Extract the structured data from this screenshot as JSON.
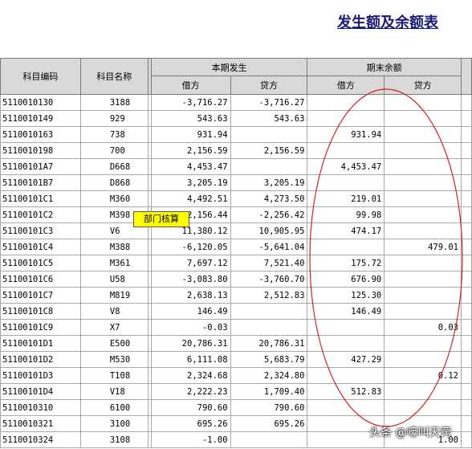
{
  "report": {
    "title": "发生额及余额表"
  },
  "headers": {
    "code": "科目编码",
    "name": "科目名称",
    "period_group": "本期发生",
    "balance_group": "期末余额",
    "debit": "借方",
    "credit": "贷方"
  },
  "rows": [
    {
      "code": "5110010130",
      "name": "3188",
      "pd": "-3,716.27",
      "pc": "-3,716.27",
      "bd": "",
      "bc": ""
    },
    {
      "code": "5110010149",
      "name": "929",
      "pd": "543.63",
      "pc": "543.63",
      "bd": "",
      "bc": ""
    },
    {
      "code": "5110010163",
      "name": "738",
      "pd": "931.94",
      "pc": "",
      "bd": "931.94",
      "bc": ""
    },
    {
      "code": "5110010198",
      "name": "700",
      "pd": "2,156.59",
      "pc": "2,156.59",
      "bd": "",
      "bc": ""
    },
    {
      "code": "51100101A7",
      "name": "D668",
      "pd": "4,453.47",
      "pc": "",
      "bd": "4,453.47",
      "bc": ""
    },
    {
      "code": "51100101B7",
      "name": "D868",
      "pd": "3,205.19",
      "pc": "3,205.19",
      "bd": "",
      "bc": ""
    },
    {
      "code": "51100101C1",
      "name": "M360",
      "pd": "4,492.51",
      "pc": "4,273.50",
      "bd": "219.01",
      "bc": ""
    },
    {
      "code": "51100101C2",
      "name": "M398",
      "pd": "-2,156.44",
      "pc": "-2,256.42",
      "bd": "99.98",
      "bc": ""
    },
    {
      "code": "51100101C3",
      "name": "V6",
      "pd": "11,380.12",
      "pc": "10,905.95",
      "bd": "474.17",
      "bc": ""
    },
    {
      "code": "51100101C4",
      "name": "M388",
      "pd": "-6,120.05",
      "pc": "-5,641.04",
      "bd": "",
      "bc": "479.01"
    },
    {
      "code": "51100101C5",
      "name": "M361",
      "pd": "7,697.12",
      "pc": "7,521.40",
      "bd": "175.72",
      "bc": ""
    },
    {
      "code": "51100101C6",
      "name": "U58",
      "pd": "-3,083.80",
      "pc": "-3,760.70",
      "bd": "676.90",
      "bc": ""
    },
    {
      "code": "51100101C7",
      "name": "M819",
      "pd": "2,638.13",
      "pc": "2,512.83",
      "bd": "125.30",
      "bc": ""
    },
    {
      "code": "51100101C8",
      "name": "V8",
      "pd": "146.49",
      "pc": "",
      "bd": "146.49",
      "bc": ""
    },
    {
      "code": "51100101C9",
      "name": "X7",
      "pd": "-0.03",
      "pc": "",
      "bd": "",
      "bc": "0.03"
    },
    {
      "code": "51100101D1",
      "name": "E500",
      "pd": "20,786.31",
      "pc": "20,786.31",
      "bd": "",
      "bc": ""
    },
    {
      "code": "51100101D2",
      "name": "M530",
      "pd": "6,111.08",
      "pc": "5,683.79",
      "bd": "427.29",
      "bc": ""
    },
    {
      "code": "51100101D3",
      "name": "T108",
      "pd": "2,324.68",
      "pc": "2,324.80",
      "bd": "",
      "bc": "0.12"
    },
    {
      "code": "51100101D4",
      "name": "V18",
      "pd": "2,222.23",
      "pc": "1,709.40",
      "bd": "512.83",
      "bc": ""
    },
    {
      "code": "5110010310",
      "name": "6100",
      "pd": "790.60",
      "pc": "790.60",
      "bd": "",
      "bc": ""
    },
    {
      "code": "5110010321",
      "name": "3100",
      "pd": "695.26",
      "pc": "695.26",
      "bd": "",
      "bc": ""
    },
    {
      "code": "5110010324",
      "name": "3108",
      "pd": "-1.00",
      "pc": "",
      "bd": "",
      "bc": "1.00"
    }
  ],
  "tooltip": {
    "text": "部门核算"
  },
  "watermark": {
    "text": "头条 @嚎叫天窍"
  },
  "colors": {
    "header_bg": "#d9d9d9",
    "tooltip_bg": "#ffff00",
    "oval": "#d42020",
    "title": "#1a1a7a"
  }
}
